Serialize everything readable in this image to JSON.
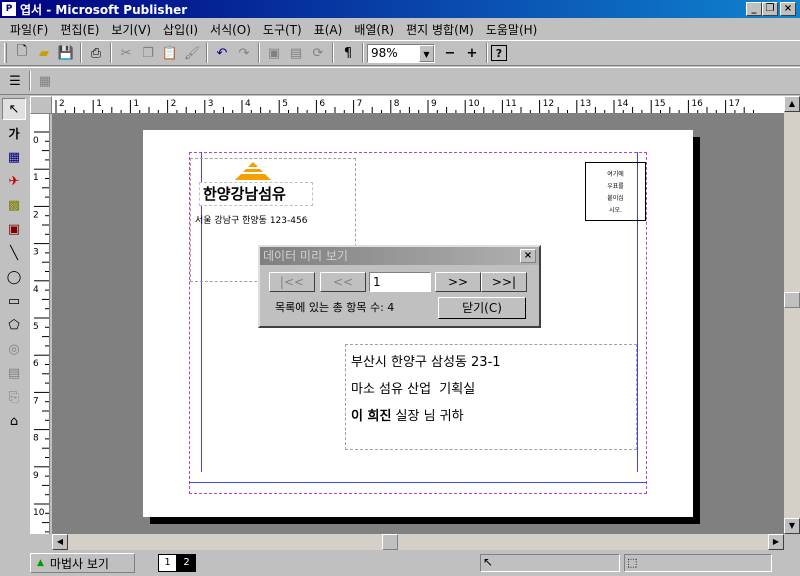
{
  "window": {
    "title": "엽서 - Microsoft Publisher",
    "app_icon": "publisher-icon"
  },
  "menu": [
    "파일(F)",
    "편집(E)",
    "보기(V)",
    "삽입(I)",
    "서식(O)",
    "도구(T)",
    "표(A)",
    "배열(R)",
    "편지 병합(M)",
    "도움말(H)"
  ],
  "toolbar": {
    "zoom_value": "98%"
  },
  "ruler": {
    "h_labels": [
      "2",
      "1",
      "1",
      "2",
      "3",
      "4",
      "5",
      "6",
      "7",
      "8",
      "9",
      "10",
      "11",
      "12",
      "13",
      "14",
      "15",
      "16",
      "17"
    ],
    "v_labels": [
      "0",
      "1",
      "2",
      "3",
      "4",
      "5",
      "6",
      "7",
      "8",
      "9",
      "10"
    ]
  },
  "postcard": {
    "company_name": "한양강남섬유",
    "sender_address": "서울 강남구 한양동 123-456",
    "stamp_text": [
      "여기에",
      "우표를",
      "붙이십",
      "시오."
    ],
    "recipient_address": "부산시 한양구 삼성동 23-1",
    "recipient_company": "마소 섬유 산업  기획실",
    "recipient_name": "이 희진",
    "recipient_suffix": " 실장 님 귀하"
  },
  "dialog": {
    "title": "데이터 미리 보기",
    "first_label": "|<<",
    "prev_label": "<<",
    "record_value": "1",
    "next_label": ">>",
    "last_label": ">>|",
    "count_text": "목록에 있는 총 항목 수: 4",
    "close_label": "닫기(C)"
  },
  "status": {
    "wizard_label": "마법사 보기",
    "pages": [
      "1",
      "2"
    ]
  },
  "colors": {
    "title_active": "#000080",
    "logo_orange": "#f5a000"
  }
}
